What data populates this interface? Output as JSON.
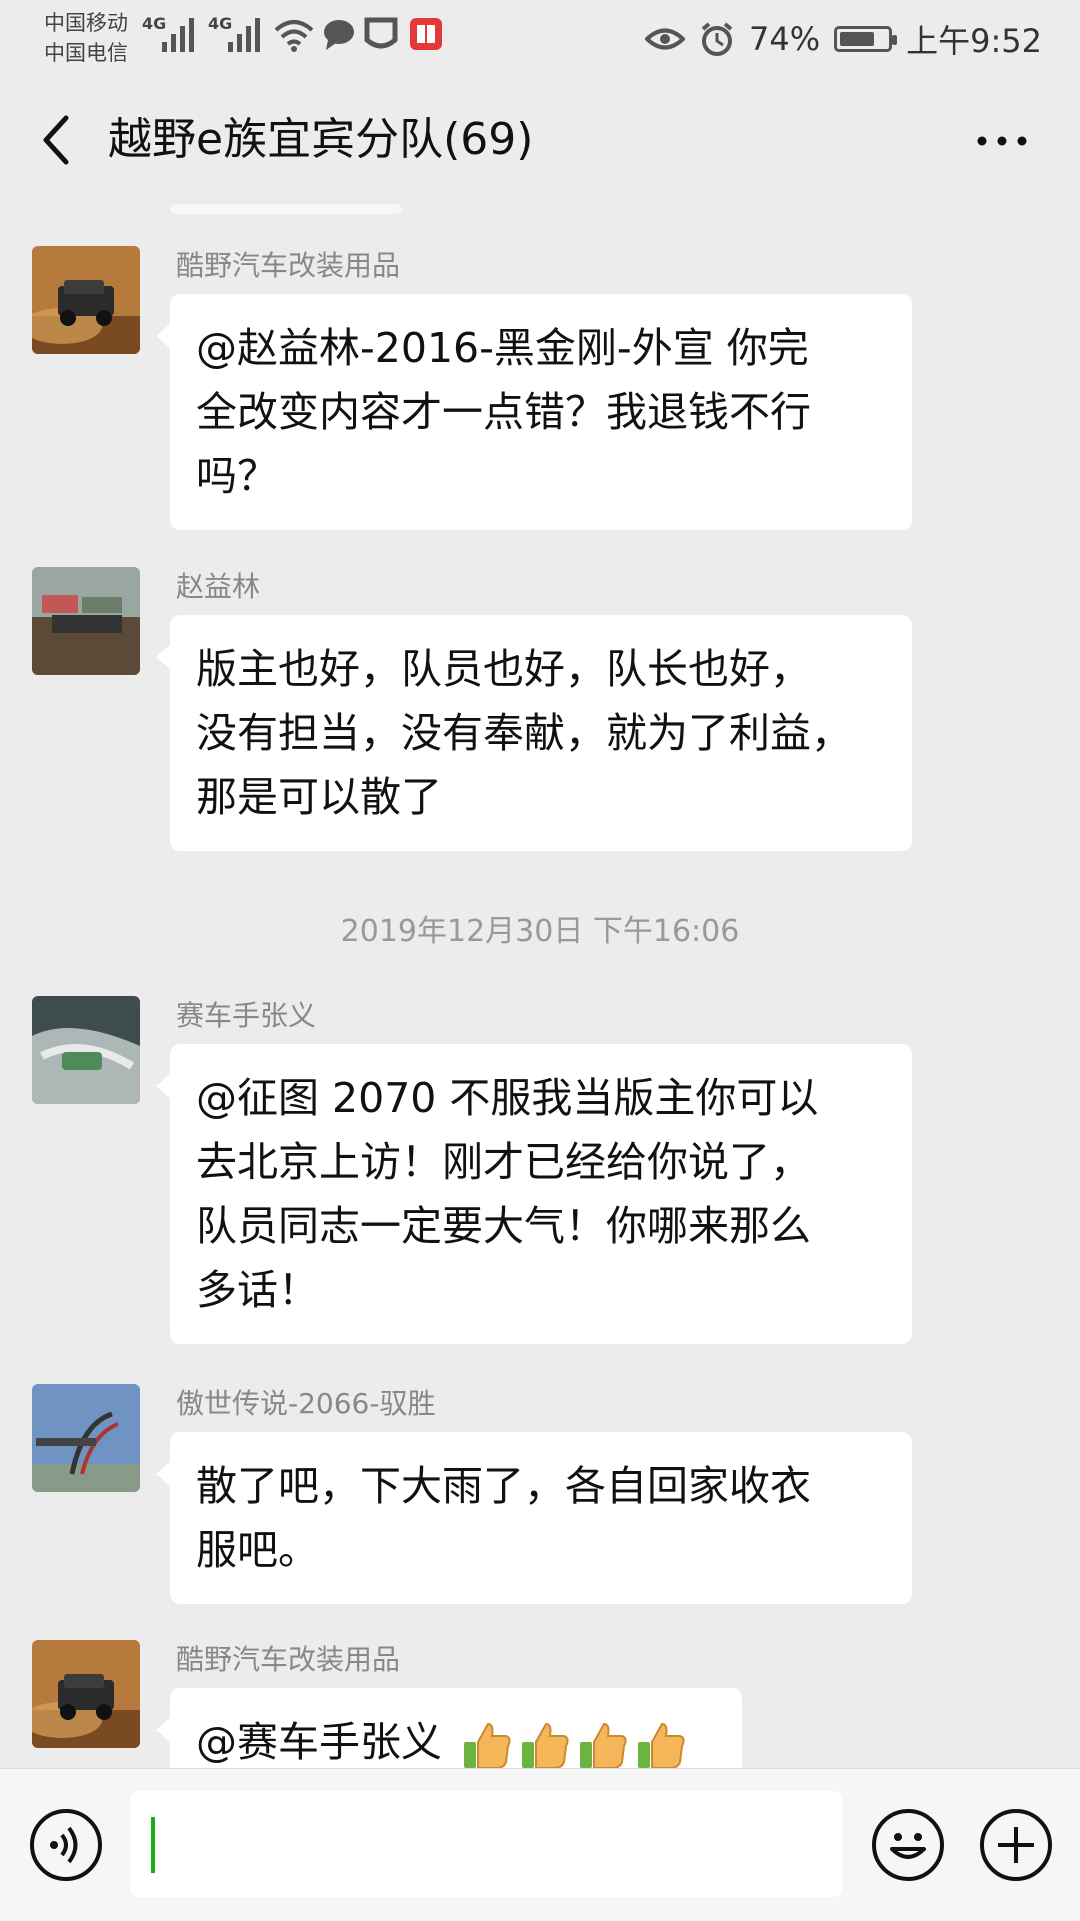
{
  "status_bar": {
    "carrier1": "中国移动",
    "carrier2": "中国电信",
    "net1": "4G",
    "net2": "4G",
    "battery_percent": "74%",
    "battery_level": 0.74,
    "time": "上午9:52",
    "icons": [
      "signal-icon",
      "wifi-icon",
      "chat-notification-icon",
      "app-notification-icon",
      "book-notification-icon",
      "eye-icon",
      "alarm-icon",
      "battery-icon"
    ]
  },
  "header": {
    "title": "越野e族宜宾分队(69)",
    "back_icon": "back-arrow-icon",
    "more_icon": "more-dots-icon"
  },
  "messages": [
    {
      "sender": "酷野汽车改装用品",
      "lines": [
        "@赵益林-2016-黑金刚-外宣  你完",
        "全改变内容才一点错？我退钱不行",
        "吗？"
      ]
    },
    {
      "sender": "赵益林",
      "lines": [
        "版主也好，队员也好，队长也好，",
        "没有担当，没有奉献，就为了利益，",
        "那是可以散了"
      ]
    },
    {
      "sender": "赛车手张义",
      "lines": [
        "@征图 2070  不服我当版主你可以",
        "去北京上访！刚才已经给你说了，",
        "队员同志一定要大气！你哪来那么",
        "多话！"
      ]
    },
    {
      "sender": "傲世传说-2066-驭胜",
      "lines": [
        "散了吧，下大雨了，各自回家收衣",
        "服吧。"
      ]
    },
    {
      "sender": "酷野汽车改装用品",
      "lines": [
        "@赛车手张义"
      ],
      "emoji": [
        "thumbs-up-icon",
        "thumbs-up-icon",
        "thumbs-up-icon",
        "thumbs-up-icon"
      ]
    }
  ],
  "timestamp": "2019年12月30日 下午16:06",
  "input_bar": {
    "value": "",
    "icons": [
      "voice-icon",
      "emoji-icon",
      "plus-icon"
    ]
  },
  "colors": {
    "background": "#ececec",
    "bubble": "#ffffff",
    "caret": "#1aad19"
  }
}
